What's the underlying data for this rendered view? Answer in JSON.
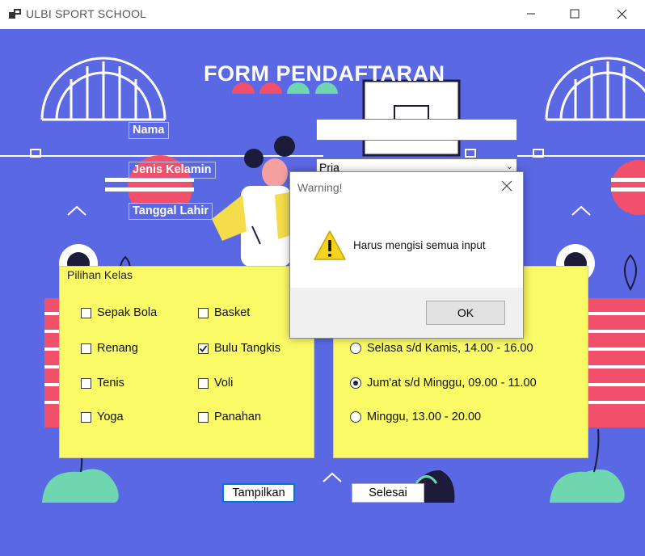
{
  "window": {
    "title": "ULBI SPORT SCHOOL",
    "controls": {
      "minimize": "—",
      "maximize": "☐",
      "close": "✕"
    }
  },
  "form": {
    "title": "FORM PENDAFTARAN",
    "nama_label": "Nama",
    "nama_value": "",
    "jenis_kelamin_label": "Jenis Kelamin",
    "jenis_kelamin_value": "Pria",
    "tanggal_lahir_label": "Tanggal Lahir"
  },
  "kelas": {
    "legend": "Pilihan Kelas",
    "options": [
      {
        "label": "Sepak Bola",
        "checked": false
      },
      {
        "label": "Basket",
        "checked": false
      },
      {
        "label": "Renang",
        "checked": false
      },
      {
        "label": "Bulu Tangkis",
        "checked": true
      },
      {
        "label": "Tenis",
        "checked": false
      },
      {
        "label": "Voli",
        "checked": false
      },
      {
        "label": "Yoga",
        "checked": false
      },
      {
        "label": "Panahan",
        "checked": false
      }
    ]
  },
  "jadwal": {
    "options": [
      {
        "label": "Selasa s/d Kamis, 14.00 - 16.00",
        "selected": false
      },
      {
        "label": "Jum'at s/d Minggu, 09.00 - 11.00",
        "selected": true
      },
      {
        "label": "Minggu, 13.00 - 20.00",
        "selected": false
      }
    ]
  },
  "buttons": {
    "tampilkan": "Tampilkan",
    "selesai": "Selesai"
  },
  "dialog": {
    "title": "Warning!",
    "message": "Harus mengisi semua input",
    "ok_label": "OK",
    "icon": "warning-icon"
  },
  "colors": {
    "background": "#5b68e4",
    "panel": "#fafa66",
    "accent_red": "#f0506a",
    "accent_green": "#6fd6b0",
    "focus_border": "#0078d7"
  }
}
